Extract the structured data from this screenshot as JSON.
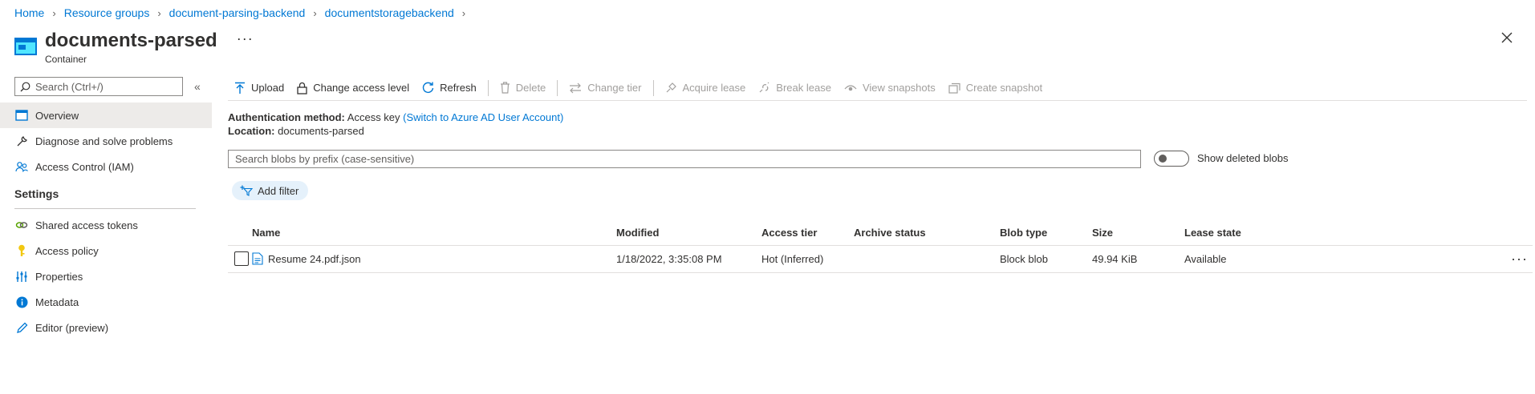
{
  "breadcrumb": [
    "Home",
    "Resource groups",
    "document-parsing-backend",
    "documentstoragebackend"
  ],
  "title": "documents-parsed",
  "subtitle": "Container",
  "more_glyph": "···",
  "leftnav": {
    "search_placeholder": "Search (Ctrl+/)",
    "collapse_glyph": "«",
    "items_top": [
      {
        "label": "Overview",
        "icon": "overview-icon",
        "active": true
      },
      {
        "label": "Diagnose and solve problems",
        "icon": "wrench-icon"
      },
      {
        "label": "Access Control (IAM)",
        "icon": "people-icon"
      }
    ],
    "section_settings": "Settings",
    "items_settings": [
      {
        "label": "Shared access tokens",
        "icon": "link-icon"
      },
      {
        "label": "Access policy",
        "icon": "key-icon"
      },
      {
        "label": "Properties",
        "icon": "sliders-icon"
      },
      {
        "label": "Metadata",
        "icon": "info-icon"
      },
      {
        "label": "Editor (preview)",
        "icon": "pencil-icon"
      }
    ]
  },
  "toolbar": {
    "upload": "Upload",
    "change_access": "Change access level",
    "refresh": "Refresh",
    "delete": "Delete",
    "change_tier": "Change tier",
    "acquire_lease": "Acquire lease",
    "break_lease": "Break lease",
    "view_snapshots": "View snapshots",
    "create_snapshot": "Create snapshot"
  },
  "info": {
    "auth_label": "Authentication method:",
    "auth_value": "Access key",
    "auth_link": "(Switch to Azure AD User Account)",
    "location_label": "Location:",
    "location_value": "documents-parsed"
  },
  "blob_search_placeholder": "Search blobs by prefix (case-sensitive)",
  "show_deleted_label": "Show deleted blobs",
  "add_filter": "Add filter",
  "table": {
    "headers": [
      "Name",
      "Modified",
      "Access tier",
      "Archive status",
      "Blob type",
      "Size",
      "Lease state"
    ],
    "rows": [
      {
        "name": "Resume 24.pdf.json",
        "modified": "1/18/2022, 3:35:08 PM",
        "tier": "Hot (Inferred)",
        "archive": "",
        "type": "Block blob",
        "size": "49.94 KiB",
        "lease": "Available"
      }
    ]
  },
  "colors": {
    "accent": "#0078d4",
    "container_icon": "#0078d4",
    "key_icon": "#f2c811"
  }
}
